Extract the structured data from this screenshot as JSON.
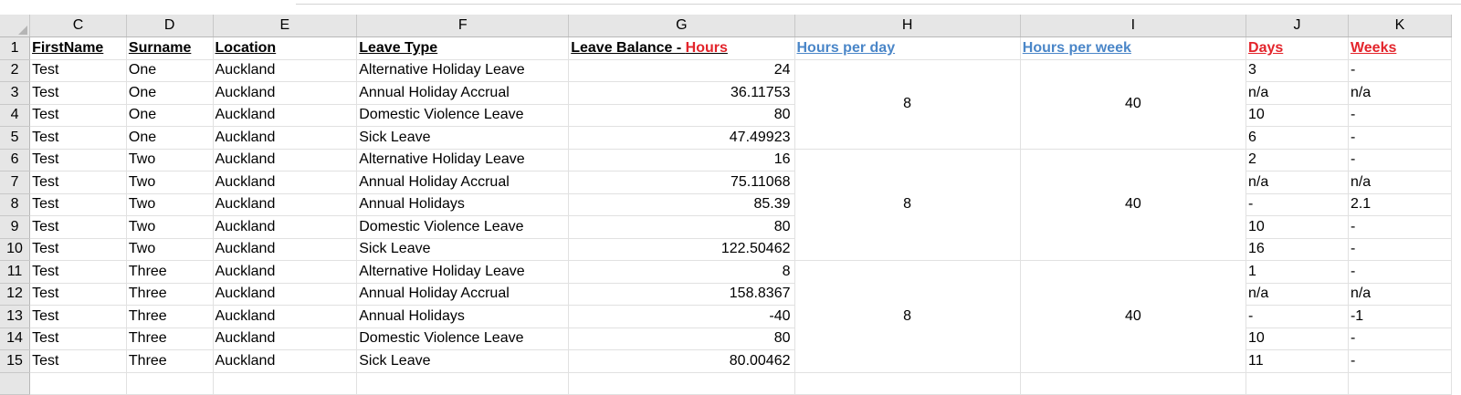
{
  "columns": [
    "C",
    "D",
    "E",
    "F",
    "G",
    "H",
    "I",
    "J",
    "K"
  ],
  "row_numbers": [
    "1",
    "2",
    "3",
    "4",
    "5",
    "6",
    "7",
    "8",
    "9",
    "10",
    "11",
    "12",
    "13",
    "14",
    "15"
  ],
  "headers": {
    "first_name": "FirstName",
    "surname": "Surname",
    "location": "Location",
    "leave_type": "Leave Type",
    "leave_balance_prefix": "Leave Balance - ",
    "leave_balance_unit": "Hours",
    "hours_per_day": "Hours per day",
    "hours_per_week": "Hours per week",
    "days": "Days",
    "weeks": "Weeks"
  },
  "rows": [
    {
      "first": "Test",
      "surname": "One",
      "location": "Auckland",
      "leave_type": "Alternative Holiday Leave",
      "balance": "24",
      "days": "3",
      "weeks": "-"
    },
    {
      "first": "Test",
      "surname": "One",
      "location": "Auckland",
      "leave_type": "Annual Holiday Accrual",
      "balance": "36.11753",
      "days": "n/a",
      "weeks": "n/a"
    },
    {
      "first": "Test",
      "surname": "One",
      "location": "Auckland",
      "leave_type": "Domestic Violence Leave",
      "balance": "80",
      "days": "10",
      "weeks": "-"
    },
    {
      "first": "Test",
      "surname": "One",
      "location": "Auckland",
      "leave_type": "Sick Leave",
      "balance": "47.49923",
      "days": "6",
      "weeks": "-"
    },
    {
      "first": "Test",
      "surname": "Two",
      "location": "Auckland",
      "leave_type": "Alternative Holiday Leave",
      "balance": "16",
      "days": "2",
      "weeks": "-"
    },
    {
      "first": "Test",
      "surname": "Two",
      "location": "Auckland",
      "leave_type": "Annual Holiday Accrual",
      "balance": "75.11068",
      "days": "n/a",
      "weeks": "n/a"
    },
    {
      "first": "Test",
      "surname": "Two",
      "location": "Auckland",
      "leave_type": "Annual Holidays",
      "balance": "85.39",
      "days": "-",
      "weeks": "2.1"
    },
    {
      "first": "Test",
      "surname": "Two",
      "location": "Auckland",
      "leave_type": "Domestic Violence Leave",
      "balance": "80",
      "days": "10",
      "weeks": "-"
    },
    {
      "first": "Test",
      "surname": "Two",
      "location": "Auckland",
      "leave_type": "Sick Leave",
      "balance": "122.50462",
      "days": "16",
      "weeks": "-"
    },
    {
      "first": "Test",
      "surname": "Three",
      "location": "Auckland",
      "leave_type": "Alternative Holiday Leave",
      "balance": "8",
      "days": "1",
      "weeks": "-"
    },
    {
      "first": "Test",
      "surname": "Three",
      "location": "Auckland",
      "leave_type": "Annual Holiday Accrual",
      "balance": "158.8367",
      "days": "n/a",
      "weeks": "n/a"
    },
    {
      "first": "Test",
      "surname": "Three",
      "location": "Auckland",
      "leave_type": "Annual Holidays",
      "balance": "-40",
      "days": "-",
      "weeks": "-1"
    },
    {
      "first": "Test",
      "surname": "Three",
      "location": "Auckland",
      "leave_type": "Domestic Violence Leave",
      "balance": "80",
      "days": "10",
      "weeks": "-"
    },
    {
      "first": "Test",
      "surname": "Three",
      "location": "Auckland",
      "leave_type": "Sick Leave",
      "balance": "80.00462",
      "days": "11",
      "weeks": "-"
    }
  ],
  "merged_groups": [
    {
      "hours_per_day": "8",
      "hours_per_week": "40"
    },
    {
      "hours_per_day": "8",
      "hours_per_week": "40"
    },
    {
      "hours_per_day": "8",
      "hours_per_week": "40"
    }
  ],
  "colors": {
    "header_blue": "#4a86c8",
    "header_red": "#e3242b",
    "grid": "#e1e1e1",
    "heading_bg": "#e6e6e6"
  }
}
